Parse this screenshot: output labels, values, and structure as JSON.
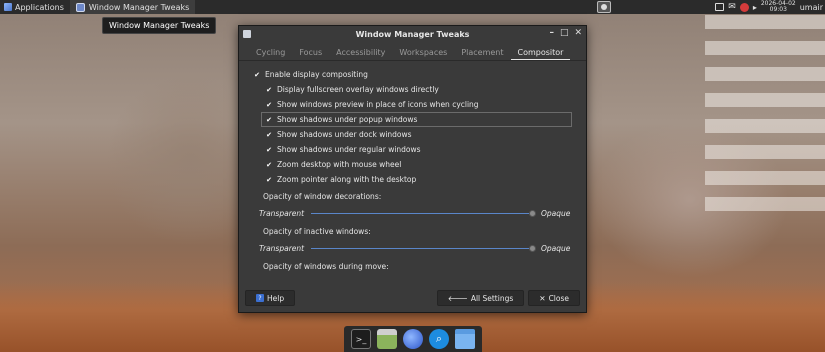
{
  "top_panel": {
    "applications_label": "Applications",
    "task_label": "Window Manager Tweaks",
    "clock_date": "2026-04-02",
    "clock_time": "09:03",
    "user": "umair"
  },
  "tooltip": "Window Manager Tweaks",
  "dialog": {
    "title": "Window Manager Tweaks",
    "tabs": [
      "Cycling",
      "Focus",
      "Accessibility",
      "Workspaces",
      "Placement",
      "Compositor"
    ],
    "active_tab": "Compositor",
    "options": [
      {
        "label": "Enable display compositing",
        "checked": true
      },
      {
        "label": "Display fullscreen overlay windows directly",
        "checked": true
      },
      {
        "label": "Show windows preview in place of icons when cycling",
        "checked": true
      },
      {
        "label": "Show shadows under popup windows",
        "checked": true
      },
      {
        "label": "Show shadows under dock windows",
        "checked": true
      },
      {
        "label": "Show shadows under regular windows",
        "checked": true
      },
      {
        "label": "Zoom desktop with mouse wheel",
        "checked": true
      },
      {
        "label": "Zoom pointer along with the desktop",
        "checked": true
      }
    ],
    "opacity_decorations_label": "Opacity of window decorations:",
    "opacity_inactive_label": "Opacity of inactive windows:",
    "opacity_move_label": "Opacity of windows during move:",
    "slider_min_label": "Transparent",
    "slider_max_label": "Opaque",
    "opacity_decorations_value": 100,
    "opacity_inactive_value": 100,
    "help_label": "Help",
    "all_settings_label": "All Settings",
    "close_label": "Close"
  },
  "dock": {
    "items": [
      "terminal-icon",
      "file-manager-icon",
      "web-browser-icon",
      "app-finder-icon",
      "folder-icon"
    ]
  },
  "colors": {
    "dialog_bg": "#3a3a3a",
    "slider_accent": "#5a86c9",
    "panel_bg": "#2b2b2b"
  }
}
